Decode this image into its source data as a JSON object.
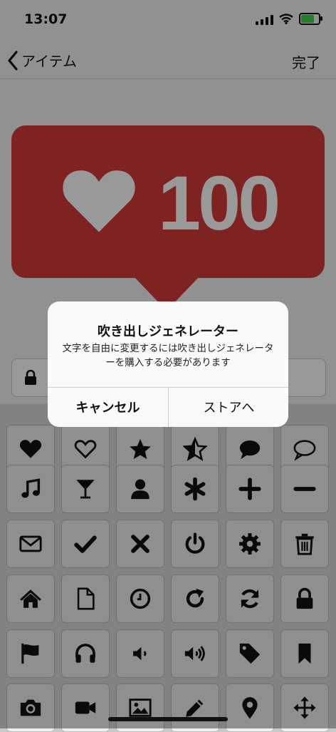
{
  "status": {
    "time": "13:07"
  },
  "nav": {
    "back_label": "アイテム",
    "done_label": "完了"
  },
  "preview": {
    "count": "100",
    "bubble_color": "#d2393a"
  },
  "alert": {
    "title": "吹き出しジェネレーター",
    "message": "文字を自由に変更するには吹き出しジェネレーターを購入する必要があります",
    "cancel_label": "キャンセル",
    "store_label": "ストアへ"
  },
  "icons": [
    "heart-filled-icon",
    "heart-outline-icon",
    "star-filled-icon",
    "star-half-icon",
    "speech-filled-icon",
    "speech-outline-icon",
    "music-note-icon",
    "cocktail-icon",
    "user-icon",
    "asterisk-icon",
    "plus-icon",
    "minus-icon",
    "envelope-icon",
    "check-icon",
    "x-icon",
    "power-icon",
    "gear-icon",
    "trash-icon",
    "home-icon",
    "file-icon",
    "clock-icon",
    "redo-icon",
    "refresh-icon",
    "lock-icon",
    "flag-icon",
    "headphones-icon",
    "volume-low-icon",
    "volume-high-icon",
    "tag-icon",
    "bookmark-icon",
    "camera-icon",
    "video-icon",
    "image-icon",
    "pencil-icon",
    "map-marker-icon",
    "move-icon"
  ]
}
